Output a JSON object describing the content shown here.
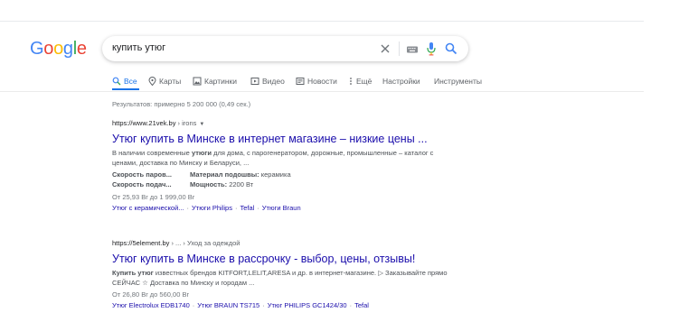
{
  "search": {
    "logo_letters": [
      {
        "ch": "G",
        "color": "#4285F4"
      },
      {
        "ch": "o",
        "color": "#EA4335"
      },
      {
        "ch": "o",
        "color": "#FBBC05"
      },
      {
        "ch": "g",
        "color": "#4285F4"
      },
      {
        "ch": "l",
        "color": "#34A853"
      },
      {
        "ch": "e",
        "color": "#EA4335"
      }
    ],
    "query": "купить утюг",
    "icons": [
      "clear-icon",
      "keyboard-icon",
      "microphone-icon",
      "search-icon"
    ]
  },
  "tabs": [
    {
      "label": "Все",
      "icon": "search-icon",
      "active": true
    },
    {
      "label": "Карты",
      "icon": "map-pin-icon"
    },
    {
      "label": "Картинки",
      "icon": "image-icon"
    },
    {
      "label": "Видео",
      "icon": "video-icon"
    },
    {
      "label": "Новости",
      "icon": "news-icon"
    },
    {
      "label": "Ещё",
      "icon": "more-icon"
    },
    {
      "label": "Настройки"
    },
    {
      "label": "Инструменты"
    }
  ],
  "stats": "Результатов: примерно 5 200 000 (0,49 сек.)",
  "results": [
    {
      "domain": "https://www.21vek.by",
      "path": " › irons",
      "title": "Утюг купить в Минске в интернет магазине – низкие цены ...",
      "snippet_parts": [
        "В наличии современные ",
        "утюги",
        " для дома, с парогенератором, дорожные, промышленные – каталог с ценами, доставка по Минску и Беларуси, ..."
      ],
      "facts": [
        {
          "key": "Скорость паров...",
          "label": "Материал подошвы:",
          "value": " керамика"
        },
        {
          "key": "Скорость подач...",
          "label": "Мощность:",
          "value": " 2200 Вт"
        }
      ],
      "price": "От 25,93 Br до 1 999,00 Br",
      "sitelinks": [
        "Утюг с керамической...",
        "Утюги Philips",
        "Tefal",
        "Утюги Braun"
      ]
    },
    {
      "domain": "https://5element.by",
      "path": " › ... › Уход за одеждой",
      "title": "Утюг купить в Минске в рассрочку - выбор, цены, отзывы!",
      "snippet_parts": [
        "Купить утюг",
        " известных брендов KITFORT,LELIT,ARESA и др. в интернет-магазине. ▷ Заказывайте прямо СЕЙЧАС ☆ Доставка по Минску и городам ..."
      ],
      "price": "От 26,80 Br до 560,00 Br",
      "sitelinks": [
        "Утюг Electrolux EDB1740",
        "Утюг BRAUN TS715",
        "Утюг PHILIPS GC1424/30",
        "Tefal"
      ]
    }
  ],
  "colors": {
    "link": "#1a0dab",
    "accent": "#1a73e8",
    "muted": "#70757a"
  }
}
